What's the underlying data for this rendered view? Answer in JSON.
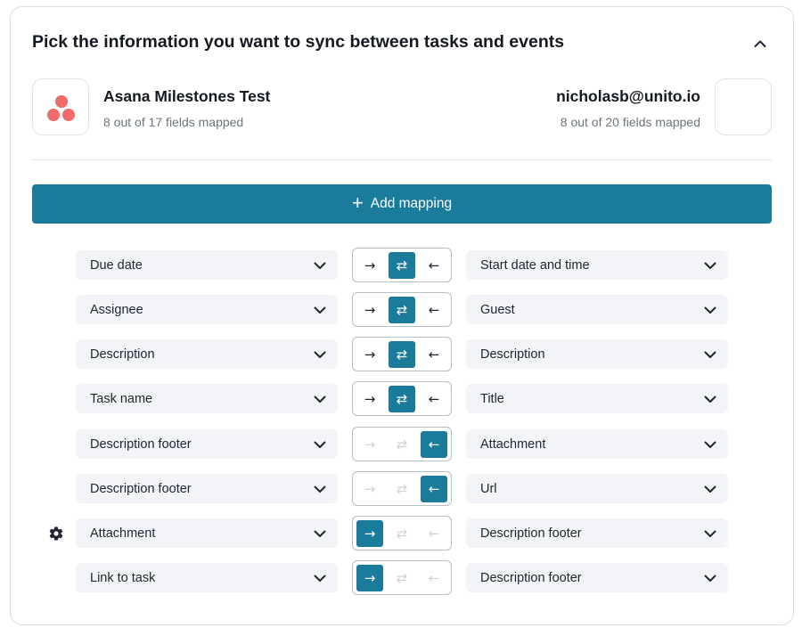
{
  "title": "Pick the information you want to sync between tasks and events",
  "left_connection": {
    "name": "Asana Milestones Test",
    "fields_mapped": "8 out of 17 fields mapped",
    "logo_icon": "asana-logo-icon"
  },
  "right_connection": {
    "name": "nicholasb@unito.io",
    "fields_mapped": "8 out of 20 fields mapped"
  },
  "add_mapping_label": "Add mapping",
  "accent_color": "#1b7b9b",
  "direction_glyphs": {
    "to_right": "→",
    "both": "⇄",
    "to_left": "←"
  },
  "mappings": [
    {
      "left": "Due date",
      "right": "Start date and time",
      "direction": "both"
    },
    {
      "left": "Assignee",
      "right": "Guest",
      "direction": "both"
    },
    {
      "left": "Description",
      "right": "Description",
      "direction": "both"
    },
    {
      "left": "Task name",
      "right": "Title",
      "direction": "both"
    },
    {
      "left": "Description footer",
      "right": "Attachment",
      "direction": "to_left"
    },
    {
      "left": "Description footer",
      "right": "Url",
      "direction": "to_left"
    },
    {
      "left": "Attachment",
      "right": "Description footer",
      "direction": "to_right",
      "has_settings": true
    },
    {
      "left": "Link to task",
      "right": "Description footer",
      "direction": "to_right"
    }
  ]
}
